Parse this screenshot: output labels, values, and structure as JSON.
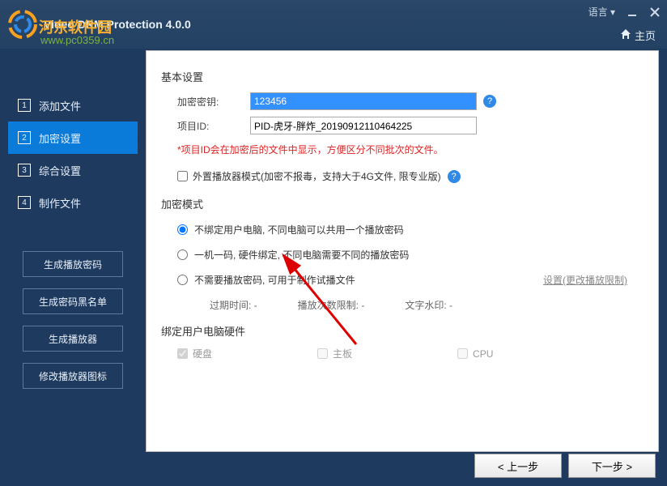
{
  "titlebar": {
    "app_name": "Video DRM Protection 4.0.0",
    "watermark_site": "河东软件园",
    "watermark_url": "www.pc0359.cn",
    "language_label": "语言",
    "breadcrumb_home": "主页"
  },
  "sidebar": {
    "nav": [
      {
        "num": "1",
        "label": "添加文件"
      },
      {
        "num": "2",
        "label": "加密设置"
      },
      {
        "num": "3",
        "label": "综合设置"
      },
      {
        "num": "4",
        "label": "制作文件"
      }
    ],
    "active_index": 1,
    "buttons": [
      "生成播放密码",
      "生成密码黑名单",
      "生成播放器",
      "修改播放器图标"
    ]
  },
  "content": {
    "basic_group_title": "基本设置",
    "key_label": "加密密钥:",
    "key_value": "123456",
    "project_label": "项目ID:",
    "project_value": "PID-虎牙-胖炸_20190912110464225",
    "project_warning": "*项目ID会在加密后的文件中显示，方便区分不同批次的文件。",
    "ext_player_label": "外置播放器模式(加密不报毒，支持大于4G文件, 限专业版)",
    "mode_group_title": "加密模式",
    "radios": [
      "不绑定用户电脑, 不同电脑可以共用一个播放密码",
      "一机一码, 硬件绑定, 不同电脑需要不同的播放密码",
      "不需要播放密码, 可用于制作试播文件"
    ],
    "selected_radio": 0,
    "setting_link": "设置(更改播放限制)",
    "sub_expire": "过期时间: -",
    "sub_playcount": "播放次数限制: -",
    "sub_watermark": "文字水印: -",
    "hw_group_title": "绑定用户电脑硬件",
    "hw_items": [
      "硬盘",
      "主板",
      "CPU"
    ],
    "hw_checked": [
      true,
      false,
      false
    ]
  },
  "footer": {
    "prev": "< 上一步",
    "next": "下一步 >"
  }
}
